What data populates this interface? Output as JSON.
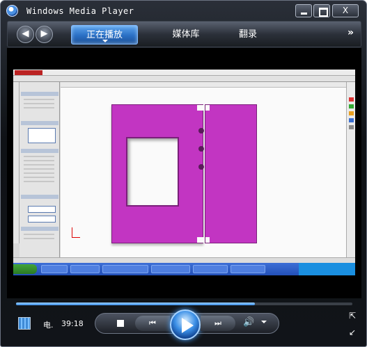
{
  "window": {
    "title": "Windows Media Player",
    "minimize_glyph": "",
    "maximize_glyph": "",
    "close_glyph": "X"
  },
  "nav": {
    "back_glyph": "◀",
    "forward_glyph": "▶",
    "tabs": [
      {
        "label": "正在播放"
      },
      {
        "label": "媒体库"
      },
      {
        "label": "翻录"
      }
    ],
    "more_glyph": "»"
  },
  "video": {
    "recorded_app_icons": {
      "part_color": "#c235c2"
    }
  },
  "playback": {
    "progress": 0.71,
    "title": "电.",
    "time": "39:18",
    "prev_glyph": "⏮",
    "next_glyph": "⏭",
    "volume_glyph": "🔊",
    "fullscreen_glyph": "⇱",
    "compact_glyph": "↙"
  },
  "colors": {
    "accent": "#2a6fc4",
    "frame": "#111419"
  }
}
